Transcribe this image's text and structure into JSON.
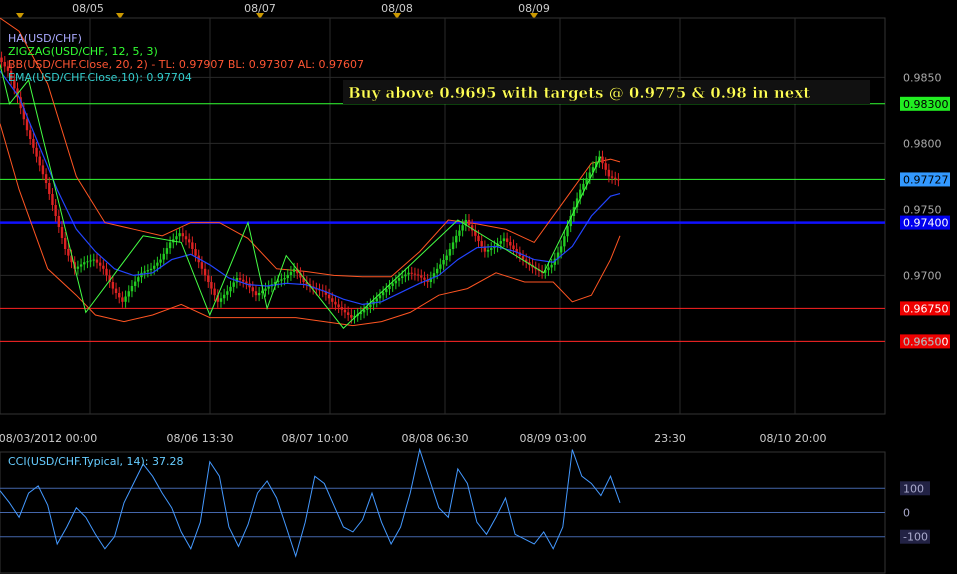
{
  "chart_data": {
    "type": "line",
    "symbol": "USD/CHF",
    "top_dates": [
      "08/05",
      "08/07",
      "08/08",
      "08/09"
    ],
    "x_labels": [
      "08/03/2012 00:00",
      "08/06 13:30",
      "08/07 10:00",
      "08/08 06:30",
      "08/09 03:00",
      "23:30",
      "08/10 20:00"
    ],
    "legend": [
      {
        "text": "HA(USD/CHF)",
        "color": "#aaaaff"
      },
      {
        "text": "ZIGZAG(USD/CHF, 12, 5, 3)",
        "color": "#33ff33"
      },
      {
        "text": "BB(USD/CHF.Close, 20, 2) -  TL: 0.97907  BL: 0.97307  AL: 0.97607",
        "color": "#ff5533"
      },
      {
        "text": "EMA(USD/CHF.Close,10): 0.97704",
        "color": "#33cccc"
      }
    ],
    "annotation": "Buy above 0.9695 with targets @ 0.9775 & 0.98 in next",
    "ylim": [
      0.9595,
      0.9895
    ],
    "y_ticks": [
      {
        "v": 0.985,
        "label": "0.9850"
      },
      {
        "v": 0.98,
        "label": "0.9800"
      },
      {
        "v": 0.975,
        "label": "0.9750"
      },
      {
        "v": 0.97,
        "label": "0.9700"
      },
      {
        "v": 0.965,
        "label": "0.9650"
      }
    ],
    "levels": [
      {
        "value": 0.983,
        "label": "0.98300",
        "line": "#33ff33",
        "badge": "#22ee22",
        "text": "#000000",
        "width": 1
      },
      {
        "value": 0.97727,
        "label": "0.97727",
        "line": "#33ff33",
        "badge": "#3399ff",
        "text": "#000000",
        "width": 1
      },
      {
        "value": 0.974,
        "label": "0.97400",
        "line": "#1111ff",
        "badge": "#0000ee",
        "text": "#ffffff",
        "width": 2.5
      },
      {
        "value": 0.9675,
        "label": "0.96750",
        "line": "#ff2222",
        "badge": "#ee0000",
        "text": "#ffffff",
        "width": 1
      },
      {
        "value": 0.965,
        "label": "0.96500",
        "line": "#ff2222",
        "badge": "#ee0000",
        "text": "#ffffff",
        "width": 1
      }
    ],
    "x_range": [
      0,
      100
    ],
    "close": [
      [
        0,
        0.9865
      ],
      [
        1,
        0.9855
      ],
      [
        2,
        0.9835
      ],
      [
        3,
        0.981
      ],
      [
        4,
        0.979
      ],
      [
        5,
        0.977
      ],
      [
        6,
        0.9745
      ],
      [
        7,
        0.972
      ],
      [
        8,
        0.9705
      ],
      [
        9,
        0.971
      ],
      [
        10,
        0.9712
      ],
      [
        11,
        0.9705
      ],
      [
        12,
        0.969
      ],
      [
        13,
        0.968
      ],
      [
        14,
        0.9692
      ],
      [
        15,
        0.9702
      ],
      [
        16,
        0.9705
      ],
      [
        17,
        0.9712
      ],
      [
        18,
        0.9725
      ],
      [
        19,
        0.9732
      ],
      [
        20,
        0.9725
      ],
      [
        21,
        0.971
      ],
      [
        22,
        0.9695
      ],
      [
        23,
        0.968
      ],
      [
        24,
        0.9688
      ],
      [
        25,
        0.9698
      ],
      [
        26,
        0.9694
      ],
      [
        27,
        0.9685
      ],
      [
        28,
        0.969
      ],
      [
        29,
        0.9695
      ],
      [
        30,
        0.9698
      ],
      [
        31,
        0.9705
      ],
      [
        32,
        0.9695
      ],
      [
        33,
        0.969
      ],
      [
        34,
        0.9688
      ],
      [
        35,
        0.968
      ],
      [
        36,
        0.9674
      ],
      [
        37,
        0.9668
      ],
      [
        38,
        0.9672
      ],
      [
        39,
        0.9678
      ],
      [
        40,
        0.9685
      ],
      [
        41,
        0.9692
      ],
      [
        42,
        0.9698
      ],
      [
        43,
        0.9702
      ],
      [
        44,
        0.97
      ],
      [
        45,
        0.9695
      ],
      [
        46,
        0.9705
      ],
      [
        47,
        0.9715
      ],
      [
        48,
        0.973
      ],
      [
        49,
        0.9742
      ],
      [
        50,
        0.973
      ],
      [
        51,
        0.9718
      ],
      [
        52,
        0.9722
      ],
      [
        53,
        0.9728
      ],
      [
        54,
        0.972
      ],
      [
        55,
        0.9712
      ],
      [
        56,
        0.9706
      ],
      [
        57,
        0.9702
      ],
      [
        58,
        0.9708
      ],
      [
        59,
        0.9722
      ],
      [
        60,
        0.9745
      ],
      [
        61,
        0.9765
      ],
      [
        62,
        0.9778
      ],
      [
        63,
        0.979
      ],
      [
        64,
        0.9775
      ],
      [
        65,
        0.9772
      ]
    ],
    "bb_upper": [
      [
        0,
        0.9895
      ],
      [
        2,
        0.9885
      ],
      [
        5,
        0.9845
      ],
      [
        8,
        0.9775
      ],
      [
        11,
        0.974
      ],
      [
        14,
        0.9735
      ],
      [
        17,
        0.973
      ],
      [
        20,
        0.974
      ],
      [
        23,
        0.974
      ],
      [
        26,
        0.9728
      ],
      [
        29,
        0.9705
      ],
      [
        32,
        0.9703
      ],
      [
        35,
        0.97
      ],
      [
        38,
        0.9699
      ],
      [
        41,
        0.9699
      ],
      [
        44,
        0.9718
      ],
      [
        47,
        0.9742
      ],
      [
        50,
        0.9739
      ],
      [
        53,
        0.9735
      ],
      [
        56,
        0.9725
      ],
      [
        59,
        0.9755
      ],
      [
        62,
        0.9785
      ],
      [
        64,
        0.9788
      ],
      [
        65,
        0.9786
      ]
    ],
    "bb_lower": [
      [
        0,
        0.9815
      ],
      [
        2,
        0.9765
      ],
      [
        5,
        0.9705
      ],
      [
        8,
        0.9685
      ],
      [
        10,
        0.967
      ],
      [
        13,
        0.9665
      ],
      [
        16,
        0.967
      ],
      [
        19,
        0.9678
      ],
      [
        22,
        0.9668
      ],
      [
        25,
        0.9668
      ],
      [
        28,
        0.9668
      ],
      [
        31,
        0.9668
      ],
      [
        34,
        0.9665
      ],
      [
        37,
        0.9662
      ],
      [
        40,
        0.9665
      ],
      [
        43,
        0.9672
      ],
      [
        46,
        0.9685
      ],
      [
        49,
        0.969
      ],
      [
        52,
        0.9702
      ],
      [
        55,
        0.9695
      ],
      [
        58,
        0.9695
      ],
      [
        60,
        0.968
      ],
      [
        62,
        0.9685
      ],
      [
        64,
        0.9712
      ],
      [
        65,
        0.973
      ]
    ],
    "ema": [
      [
        0,
        0.9855
      ],
      [
        2,
        0.9835
      ],
      [
        4,
        0.98
      ],
      [
        6,
        0.9765
      ],
      [
        8,
        0.9735
      ],
      [
        10,
        0.9718
      ],
      [
        12,
        0.9705
      ],
      [
        14,
        0.97
      ],
      [
        16,
        0.9702
      ],
      [
        18,
        0.9712
      ],
      [
        20,
        0.9716
      ],
      [
        22,
        0.9708
      ],
      [
        24,
        0.9698
      ],
      [
        26,
        0.9693
      ],
      [
        28,
        0.9692
      ],
      [
        30,
        0.9694
      ],
      [
        32,
        0.9693
      ],
      [
        34,
        0.9688
      ],
      [
        36,
        0.9682
      ],
      [
        38,
        0.9678
      ],
      [
        40,
        0.968
      ],
      [
        42,
        0.9687
      ],
      [
        44,
        0.9694
      ],
      [
        46,
        0.97
      ],
      [
        48,
        0.9712
      ],
      [
        50,
        0.9721
      ],
      [
        52,
        0.9722
      ],
      [
        54,
        0.9718
      ],
      [
        56,
        0.9712
      ],
      [
        58,
        0.971
      ],
      [
        60,
        0.9722
      ],
      [
        62,
        0.9745
      ],
      [
        64,
        0.976
      ],
      [
        65,
        0.9762
      ]
    ],
    "zigzag": [
      [
        0,
        0.986
      ],
      [
        1,
        0.983
      ],
      [
        3,
        0.9848
      ],
      [
        9,
        0.9672
      ],
      [
        15,
        0.973
      ],
      [
        19,
        0.9725
      ],
      [
        22,
        0.967
      ],
      [
        26,
        0.974
      ],
      [
        28,
        0.9675
      ],
      [
        30,
        0.9715
      ],
      [
        36,
        0.966
      ],
      [
        48,
        0.9742
      ],
      [
        57,
        0.9702
      ],
      [
        63,
        0.979
      ]
    ],
    "cci": {
      "label": "CCI(USD/CHF.Typical, 14): 37.28",
      "ylim": [
        -250,
        250
      ],
      "levels": [
        {
          "v": 100,
          "label": "100"
        },
        {
          "v": 0,
          "label": "0"
        },
        {
          "v": -100,
          "label": "-100"
        }
      ],
      "values": [
        [
          0,
          90
        ],
        [
          1,
          40
        ],
        [
          2,
          -20
        ],
        [
          3,
          80
        ],
        [
          4,
          110
        ],
        [
          5,
          30
        ],
        [
          6,
          -130
        ],
        [
          7,
          -60
        ],
        [
          8,
          20
        ],
        [
          9,
          -20
        ],
        [
          10,
          -90
        ],
        [
          11,
          -150
        ],
        [
          12,
          -100
        ],
        [
          13,
          40
        ],
        [
          14,
          120
        ],
        [
          15,
          200
        ],
        [
          16,
          150
        ],
        [
          17,
          80
        ],
        [
          18,
          20
        ],
        [
          19,
          -80
        ],
        [
          20,
          -150
        ],
        [
          21,
          -40
        ],
        [
          22,
          210
        ],
        [
          23,
          150
        ],
        [
          24,
          -60
        ],
        [
          25,
          -140
        ],
        [
          26,
          -50
        ],
        [
          27,
          80
        ],
        [
          28,
          130
        ],
        [
          29,
          60
        ],
        [
          30,
          -60
        ],
        [
          31,
          -180
        ],
        [
          32,
          -40
        ],
        [
          33,
          150
        ],
        [
          34,
          120
        ],
        [
          35,
          30
        ],
        [
          36,
          -60
        ],
        [
          37,
          -80
        ],
        [
          38,
          -30
        ],
        [
          39,
          80
        ],
        [
          40,
          -40
        ],
        [
          41,
          -130
        ],
        [
          42,
          -60
        ],
        [
          43,
          80
        ],
        [
          44,
          260
        ],
        [
          45,
          140
        ],
        [
          46,
          20
        ],
        [
          47,
          -20
        ],
        [
          48,
          180
        ],
        [
          49,
          120
        ],
        [
          50,
          -40
        ],
        [
          51,
          -90
        ],
        [
          52,
          -20
        ],
        [
          53,
          60
        ],
        [
          54,
          -90
        ],
        [
          55,
          -110
        ],
        [
          56,
          -130
        ],
        [
          57,
          -80
        ],
        [
          58,
          -150
        ],
        [
          59,
          -60
        ],
        [
          60,
          260
        ],
        [
          61,
          150
        ],
        [
          62,
          120
        ],
        [
          63,
          70
        ],
        [
          64,
          150
        ],
        [
          65,
          40
        ]
      ]
    }
  }
}
